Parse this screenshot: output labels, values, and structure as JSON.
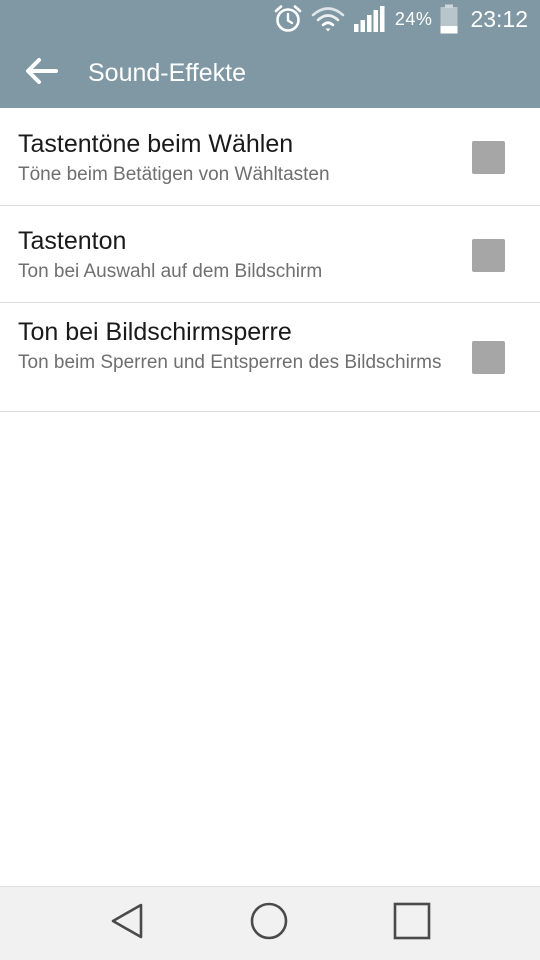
{
  "status_bar": {
    "battery_percent": "24%",
    "time": "23:12",
    "icons": [
      "alarm-icon",
      "wifi-icon",
      "signal-icon",
      "battery-icon"
    ]
  },
  "action_bar": {
    "back_icon": "back-arrow-icon",
    "title": "Sound-Effekte"
  },
  "settings": [
    {
      "label": "Tastentöne beim Wählen",
      "description": "Töne beim Betätigen von Wähltasten",
      "checked": false
    },
    {
      "label": "Tastenton",
      "description": "Ton bei Auswahl auf dem Bildschirm",
      "checked": false
    },
    {
      "label": "Ton bei Bildschirmsperre",
      "description": "Ton beim Sperren und Entsperren des Bildschirms",
      "checked": false
    }
  ],
  "nav_bar": {
    "icons": [
      "back-triangle-icon",
      "home-circle-icon",
      "recents-square-icon"
    ]
  },
  "colors": {
    "header": "#7f98a3",
    "checkbox": "#a6a6a6",
    "nav_bar": "#f1f1f1"
  }
}
